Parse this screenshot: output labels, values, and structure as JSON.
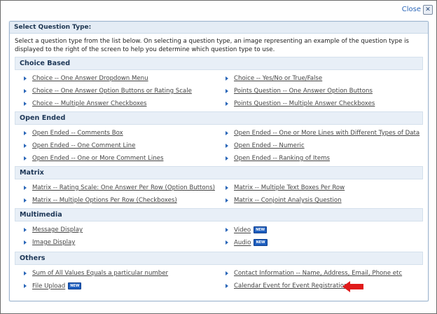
{
  "dialog": {
    "close_label": "Close",
    "close_icon": "x-icon"
  },
  "panel": {
    "title": "Select Question Type:",
    "intro": "Select a question type from the list below. On selecting a question type, an image representing an example of the question type is displayed to the right of the screen to help you determine which question type to use."
  },
  "sections": [
    {
      "title": "Choice Based",
      "left": [
        "Choice -- One Answer Dropdown Menu",
        "Choice -- One Answer Option Buttons or Rating Scale",
        "Choice -- Multiple Answer Checkboxes"
      ],
      "right": [
        "Choice -- Yes/No or True/False",
        "Points Question -- One Answer Option Buttons",
        "Points Question -- Multiple Answer Checkboxes"
      ]
    },
    {
      "title": "Open Ended",
      "left": [
        "Open Ended -- Comments Box",
        "Open Ended -- One Comment Line",
        "Open Ended -- One or More Comment Lines"
      ],
      "right": [
        "Open Ended -- One or More Lines with Different Types of Data",
        "Open Ended -- Numeric",
        "Open Ended -- Ranking of Items"
      ]
    },
    {
      "title": "Matrix",
      "left": [
        "Matrix -- Rating Scale: One Answer Per Row (Option Buttons)",
        "Matrix -- Multiple Options Per Row (Checkboxes)"
      ],
      "right": [
        "Matrix -- Multiple Text Boxes Per Row",
        "Matrix -- Conjoint Analysis Question"
      ]
    },
    {
      "title": "Multimedia",
      "left": [
        "Message Display",
        "Image Display"
      ],
      "right": [
        "Video",
        "Audio"
      ]
    },
    {
      "title": "Others",
      "left": [
        "Sum of All Values Equals a particular number",
        "File Upload"
      ],
      "right": [
        "Contact Information -- Name, Address, Email, Phone etc",
        "Calendar Event for Event Registration"
      ]
    }
  ],
  "badge_label": "NEW",
  "colors": {
    "accent": "#2a66b8",
    "section_bg": "#e8eff7",
    "arrow": "#e01b1b"
  }
}
